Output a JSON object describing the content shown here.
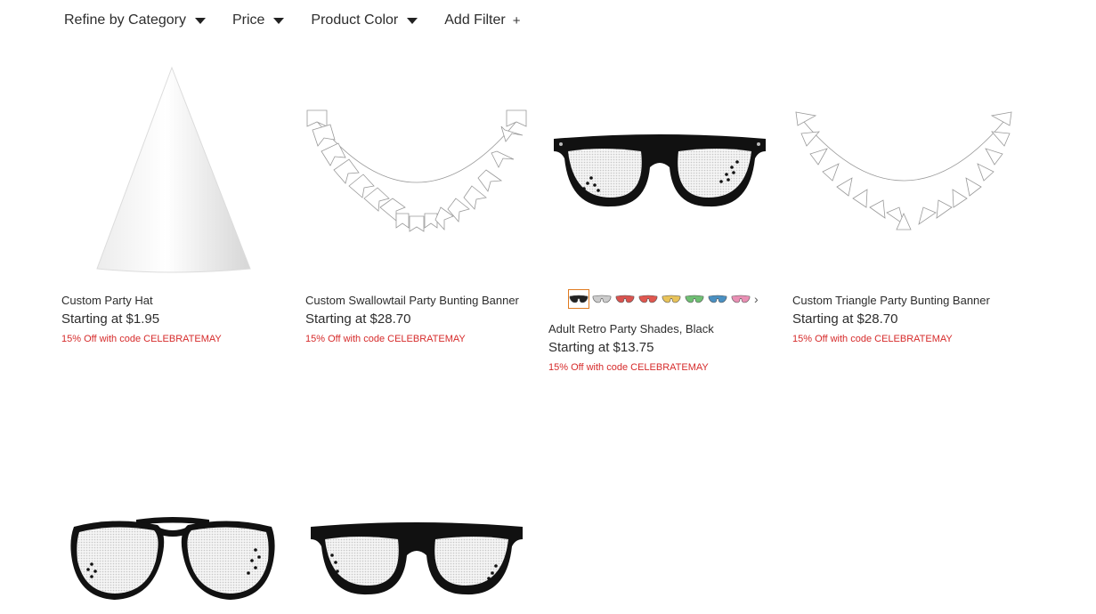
{
  "filters": [
    {
      "label": "Refine by Category",
      "icon": "caret-down-icon"
    },
    {
      "label": "Price",
      "icon": "caret-down-icon"
    },
    {
      "label": "Product Color",
      "icon": "caret-down-icon"
    },
    {
      "label": "Add Filter",
      "icon": "plus-icon",
      "icon_text": "+"
    }
  ],
  "products": [
    {
      "title": "Custom Party Hat",
      "price": "Starting at $1.95",
      "promo": "15% Off with code CELEBRATEMAY",
      "image": "party-hat"
    },
    {
      "title": "Custom Swallowtail Party Bunting Banner",
      "price": "Starting at $28.70",
      "promo": "15% Off with code CELEBRATEMAY",
      "image": "swallowtail-bunting"
    },
    {
      "title": "Adult Retro Party Shades, Black",
      "price": "Starting at $13.75",
      "promo": "15% Off with code CELEBRATEMAY",
      "image": "retro-shades",
      "swatches": [
        "#222222",
        "#cccccc",
        "#d9534f",
        "#e0574f",
        "#e8c35a",
        "#6fbf73",
        "#4a90c2",
        "#e98fb4"
      ],
      "swatch_selected": 0,
      "swatch_next": "›"
    },
    {
      "title": "Custom Triangle Party Bunting Banner",
      "price": "Starting at $28.70",
      "promo": "15% Off with code CELEBRATEMAY",
      "image": "triangle-bunting"
    },
    {
      "title": "",
      "image": "aviator-shades"
    },
    {
      "title": "",
      "image": "retro-shades-2"
    }
  ],
  "colors": {
    "promo": "#d62b2b",
    "swatch_selected_border": "#e07a1f"
  }
}
